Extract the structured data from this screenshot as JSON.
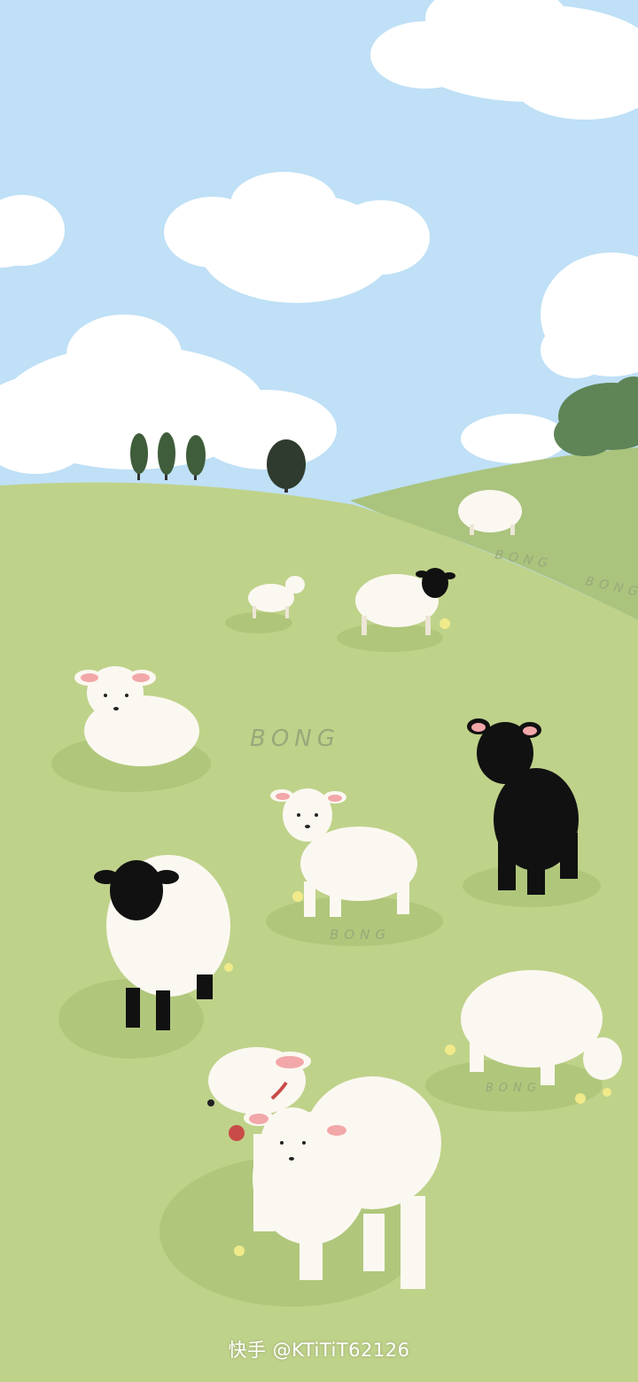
{
  "scene": {
    "description_tag": "illustration-wallpaper",
    "painted_labels": [
      "BONG",
      "BONG",
      "BONG",
      "BONG",
      "BONG"
    ]
  },
  "watermark": {
    "text": "快手 @KTiTiT62126"
  },
  "colors": {
    "sky": "#bfe0f6",
    "cloud": "#ffffff",
    "hill_far": "#aac47e",
    "meadow": "#bfd28a",
    "tree": "#5b7a52",
    "wool": "#fbf8f1",
    "black_face": "#111111",
    "ear_pink": "#f2a7a9"
  }
}
